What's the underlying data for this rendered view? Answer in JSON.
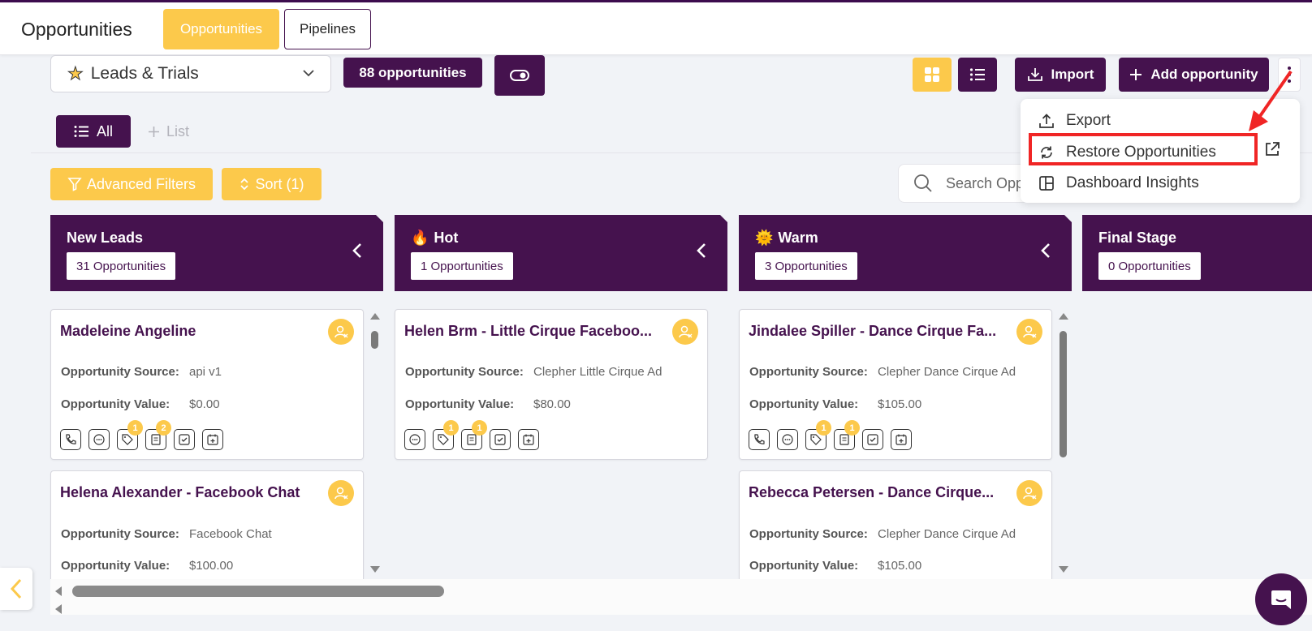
{
  "header": {
    "title": "Opportunities",
    "tabs": [
      {
        "label": "Opportunities",
        "active": true
      },
      {
        "label": "Pipelines",
        "active": false
      }
    ]
  },
  "toolbar": {
    "pipeline_select": "Leads & Trials",
    "opportunity_count": "88 opportunities",
    "import_label": "Import",
    "add_label": "Add opportunity"
  },
  "list_bar": {
    "all_label": "All",
    "add_list_label": "List"
  },
  "filters": {
    "advanced_label": "Advanced Filters",
    "sort_label": "Sort (1)",
    "search_placeholder": "Search Opportunities"
  },
  "dropdown_menu": {
    "items": [
      {
        "label": "Export",
        "icon": "upload-icon"
      },
      {
        "label": "Restore Opportunities",
        "icon": "refresh-icon",
        "highlighted": true
      },
      {
        "label": "Dashboard Insights",
        "icon": "layout-icon"
      }
    ]
  },
  "columns": [
    {
      "title": "New Leads",
      "emoji": "",
      "count": "31 Opportunities"
    },
    {
      "title": "Hot",
      "emoji": "🔥",
      "count": "1 Opportunities"
    },
    {
      "title": "Warm",
      "emoji": "🌞",
      "count": "3 Opportunities"
    },
    {
      "title": "Final Stage",
      "emoji": "",
      "count": "0 Opportunities"
    }
  ],
  "field_labels": {
    "source": "Opportunity Source:",
    "value": "Opportunity Value:"
  },
  "cards": {
    "c1": {
      "name": "Madeleine Angeline",
      "source": "api v1",
      "value": "$0.00",
      "badges": {
        "tag": "1",
        "note": "2"
      }
    },
    "c2": {
      "name": "Helena Alexander - Facebook Chat",
      "source": "Facebook Chat",
      "value": "$100.00"
    },
    "c3": {
      "name": "Helen Brm - Little Cirque Faceboo...",
      "source": "Clepher Little Cirque Ad",
      "value": "$80.00",
      "badges": {
        "tag": "1",
        "note": "1"
      }
    },
    "c4": {
      "name": "Jindalee Spiller - Dance Cirque Fa...",
      "source": "Clepher Dance Cirque Ad",
      "value": "$105.00",
      "badges": {
        "tag": "1",
        "note": "1"
      }
    },
    "c5": {
      "name": "Rebecca Petersen - Dance Cirque...",
      "source": "Clepher Dance Cirque Ad",
      "value": "$105.00"
    }
  },
  "colors": {
    "primary": "#45124e",
    "accent": "#fcc94b",
    "annotation": "#f02525"
  }
}
